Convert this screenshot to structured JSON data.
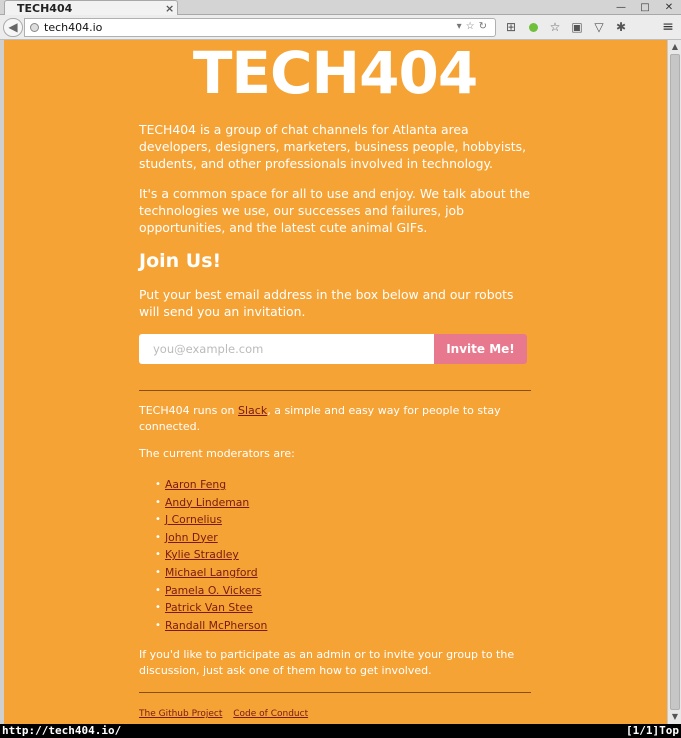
{
  "browser": {
    "tab_title": "TECH404",
    "tab_close": "×",
    "url": "tech404.io",
    "window_buttons": [
      "—",
      "□",
      "✕"
    ],
    "menu_glyph": "≡"
  },
  "page": {
    "logo": "TECH404",
    "intro_1": "TECH404 is a group of chat channels for Atlanta area developers, designers, marketers, business people, hobbyists, students, and other professionals involved in technology.",
    "intro_2": "It's a common space for all to use and enjoy. We talk about the technologies we use, our successes and failures, job opportunities, and the latest cute animal GIFs.",
    "join_heading": "Join Us!",
    "join_text": "Put your best email address in the box below and our robots will send you an invitation.",
    "email_placeholder": "you@example.com",
    "invite_button": "Invite Me!",
    "slack_prefix": "TECH404 runs on ",
    "slack_link": "Slack",
    "slack_suffix": ", a simple and easy way for people to stay connected.",
    "moderators_intro": "The current moderators are:",
    "moderators": [
      "Aaron Feng",
      "Andy Lindeman",
      "J Cornelius",
      "John Dyer",
      "Kylie Stradley",
      "Michael Langford",
      "Pamela O. Vickers",
      "Patrick Van Stee",
      "Randall McPherson"
    ],
    "admin_text": "If you'd like to participate as an admin or to invite your group to the discussion, just ask one of them how to get involved.",
    "footer_links": [
      "The Github Project",
      "Code of Conduct"
    ]
  },
  "status_bar": {
    "left": "http://tech404.io/",
    "right": "[1/1]Top"
  },
  "colors": {
    "page_bg": "#f6a335",
    "button_bg": "#e8788e",
    "link": "#7a1a12"
  }
}
